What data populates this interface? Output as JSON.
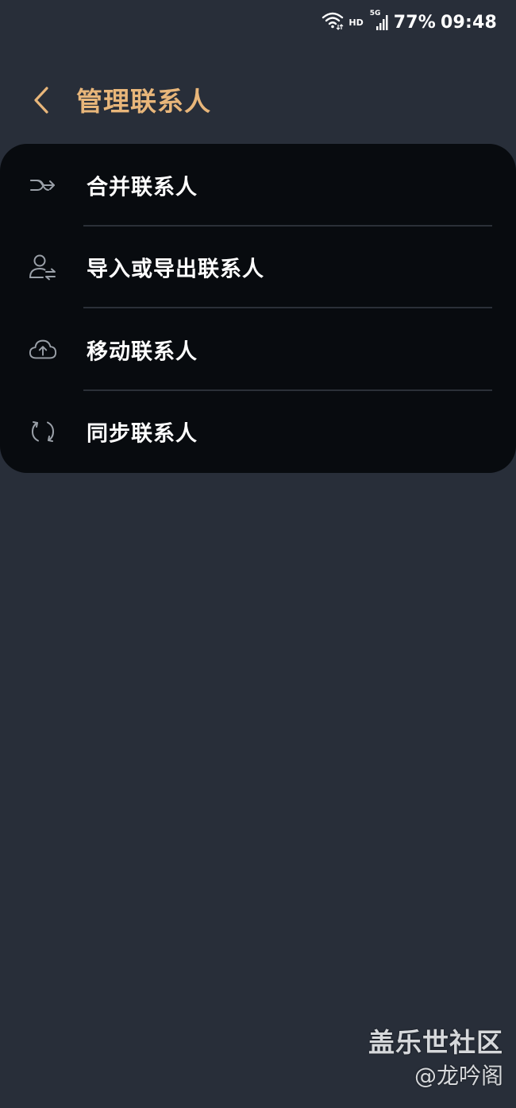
{
  "status_bar": {
    "hd": "HD",
    "network": "5G",
    "battery": "77%",
    "time": "09:48",
    "icons": [
      "wifi-icon",
      "signal-icon"
    ]
  },
  "header": {
    "back_icon": "chevron-left-icon",
    "title": "管理联系人"
  },
  "menu": {
    "items": [
      {
        "label": "合并联系人",
        "icon": "merge-icon"
      },
      {
        "label": "导入或导出联系人",
        "icon": "person-transfer-icon"
      },
      {
        "label": "移动联系人",
        "icon": "cloud-upload-icon"
      },
      {
        "label": "同步联系人",
        "icon": "sync-icon"
      }
    ]
  },
  "watermark": {
    "line1": "盖乐世社区",
    "line2": "@龙吟阁"
  },
  "colors": {
    "background": "#282e39",
    "card": "#080b0f",
    "accent": "#e8b67a",
    "divider": "#2b3038",
    "icon": "#9aa0a8"
  }
}
